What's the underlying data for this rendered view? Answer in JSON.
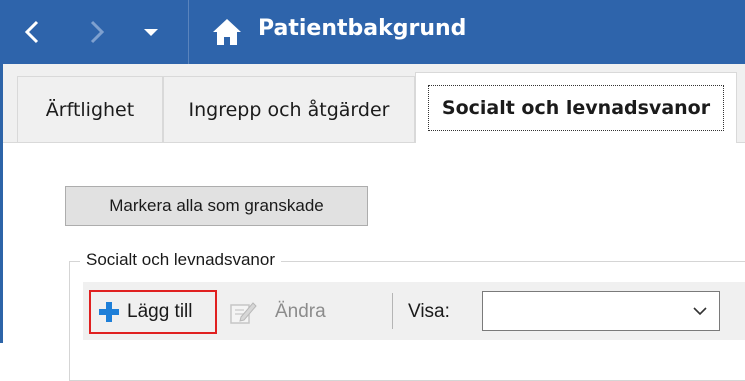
{
  "titlebar": {
    "title": "Patientbakgrund",
    "icons": {
      "back": "chevron-left-icon",
      "forward": "chevron-right-icon",
      "menu": "chevron-down-icon",
      "home": "home-icon"
    }
  },
  "tabs": [
    {
      "label": "Ärftlighet",
      "selected": false
    },
    {
      "label": "Ingrepp och åtgärder",
      "selected": false
    },
    {
      "label": "Socialt och levnadsvanor",
      "selected": true
    }
  ],
  "content": {
    "mark_all_button": "Markera alla som granskade",
    "group_title": "Socialt och levnadsvanor",
    "toolbar": {
      "add_label": "Lägg till",
      "edit_label": "Ändra",
      "show_label": "Visa:",
      "show_value": ""
    }
  },
  "colors": {
    "titlebar": "#2e64ab",
    "highlight": "#e02020",
    "add_icon": "#1e7fd8"
  }
}
